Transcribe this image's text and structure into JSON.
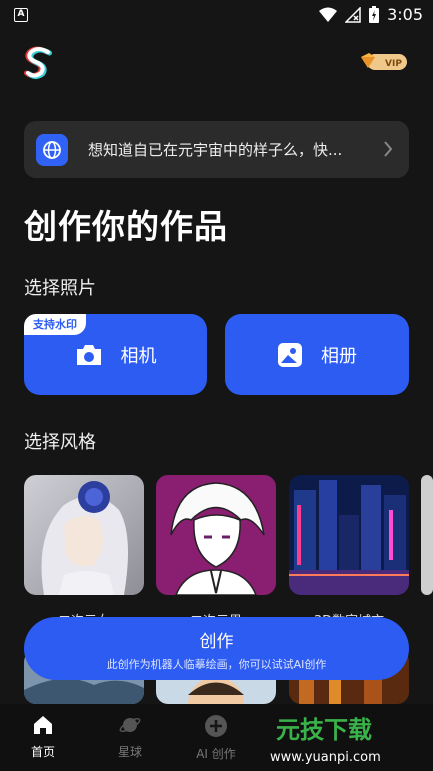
{
  "status": {
    "time": "3:05"
  },
  "banner": {
    "text": "想知道自已在元宇宙中的样子么，快..."
  },
  "page_title": "创作你的作品",
  "photo_section": {
    "title": "选择照片",
    "watermark_tag": "支持水印",
    "camera_label": "相机",
    "album_label": "相册"
  },
  "style_section": {
    "title": "选择风格",
    "styles": [
      "二次元女",
      "二次元男",
      "3D数字城市",
      ""
    ]
  },
  "create": {
    "label": "创作",
    "sub": "此创作为机器人临摹绘画，你可以试试AI创作"
  },
  "nav": [
    {
      "label": "首页",
      "active": true
    },
    {
      "label": "星球",
      "active": false
    },
    {
      "label": "AI 创作",
      "active": false
    }
  ],
  "vip_label": "VIP",
  "watermark": {
    "brand": "元技下载",
    "url": "www.yuanpi.com"
  },
  "colors": {
    "accent": "#2d5cf2",
    "background": "#151515"
  }
}
